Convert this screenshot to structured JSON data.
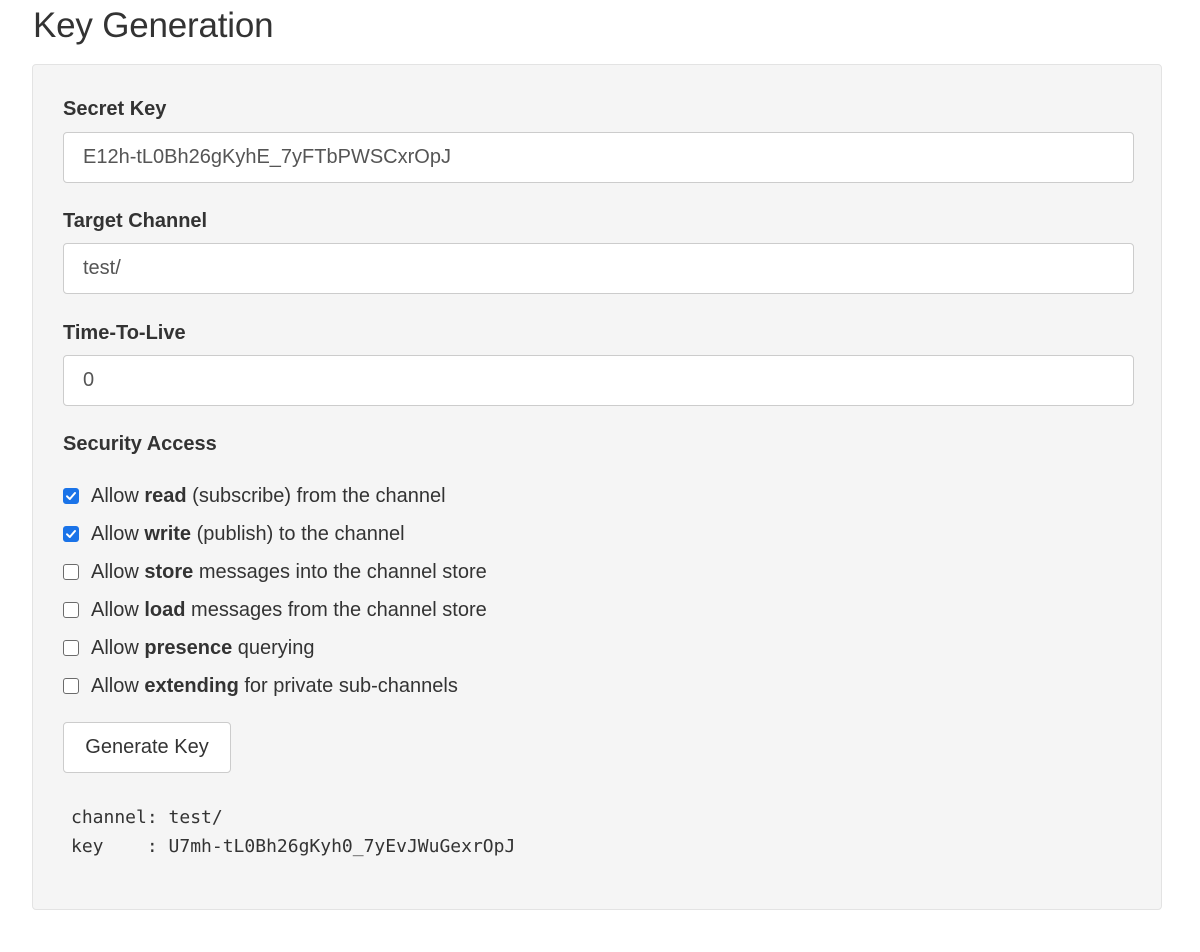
{
  "page": {
    "title": "Key Generation"
  },
  "form": {
    "secret_key": {
      "label": "Secret Key",
      "value": "E12h-tL0Bh26gKyhE_7yFTbPWSCxrOpJ"
    },
    "target_channel": {
      "label": "Target Channel",
      "value": "test/"
    },
    "ttl": {
      "label": "Time-To-Live",
      "value": "0"
    },
    "security": {
      "label": "Security Access",
      "options": [
        {
          "checked": true,
          "prefix": "Allow ",
          "bold": "read",
          "suffix": " (subscribe) from the channel"
        },
        {
          "checked": true,
          "prefix": "Allow ",
          "bold": "write",
          "suffix": " (publish) to the channel"
        },
        {
          "checked": false,
          "prefix": "Allow ",
          "bold": "store",
          "suffix": " messages into the channel store"
        },
        {
          "checked": false,
          "prefix": "Allow ",
          "bold": "load",
          "suffix": " messages from the channel store"
        },
        {
          "checked": false,
          "prefix": "Allow ",
          "bold": "presence",
          "suffix": " querying"
        },
        {
          "checked": false,
          "prefix": "Allow ",
          "bold": "extending",
          "suffix": " for private sub-channels"
        }
      ]
    },
    "generate_label": "Generate Key"
  },
  "output": {
    "channel_line": "channel: test/",
    "key_line": "key    : U7mh-tL0Bh26gKyh0_7yEvJWuGexrOpJ"
  },
  "colors": {
    "accent": "#1a73e8",
    "panel_bg": "#f5f5f5"
  }
}
